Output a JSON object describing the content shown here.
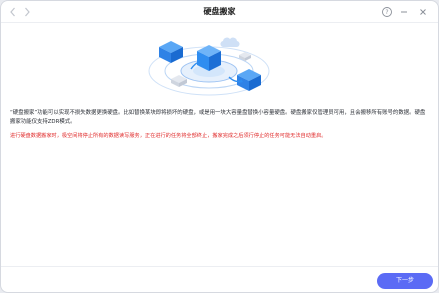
{
  "window": {
    "title": "硬盘搬家",
    "nav_back_icon": "chevron-left-icon",
    "nav_forward_icon": "chevron-right-icon",
    "help_glyph": "?",
    "minimize_glyph": "—",
    "close_glyph": "✕"
  },
  "content": {
    "description": "“硬盘搬家”功能可以实现不损失数据更换硬盘。比如替换某块即将损坏的硬盘，或是用一块大容量盘替换小容量硬盘。硬盘搬家仅管理员可用，且会搬移所有账号的数据。硬盘搬家功能仅支持ZDR模式。",
    "warning": "进行硬盘数据搬家时，极空间将停止所有的数据读写服务，正在进行的任务将全部终止，搬家完成之后须行停止的任务可能无法自动重启。"
  },
  "footer": {
    "next_label": "下一步"
  },
  "colors": {
    "accent": "#5b6bf5",
    "warning": "#e02b2b",
    "illustration_blue": "#2f8df0"
  }
}
